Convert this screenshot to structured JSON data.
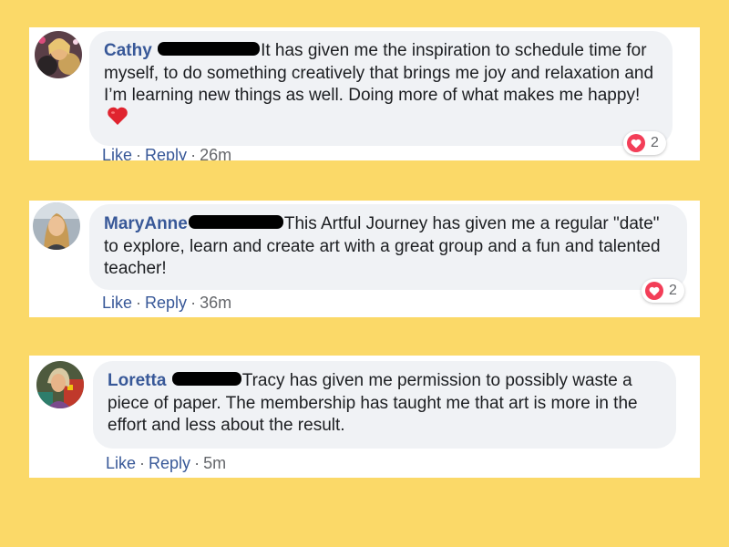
{
  "comments": [
    {
      "author": "Cathy",
      "text": "It has given me the inspiration to schedule time for myself, to do something creatively that brings me joy and relaxation and I’m learning new things as well. Doing more of what makes me happy!",
      "actions": {
        "like": "Like",
        "reply": "Reply",
        "time": "26m"
      },
      "reaction_count": "2"
    },
    {
      "author": "MaryAnne",
      "text": "This Artful Journey has given me a regular \"date\" to explore, learn and create art with a great group and a fun and talented teacher!",
      "actions": {
        "like": "Like",
        "reply": "Reply",
        "time": "36m"
      },
      "reaction_count": "2"
    },
    {
      "author": "Loretta",
      "text": "Tracy has given me permission to possibly waste a piece of paper. The membership has taught me that art is more in the effort and less about the result.",
      "actions": {
        "like": "Like",
        "reply": "Reply",
        "time": "5m"
      }
    }
  ],
  "separator": "·",
  "colors": {
    "background": "#fbd968",
    "bubble": "#f0f2f5",
    "author": "#385898",
    "meta": "#65676b",
    "love_reaction": "#f33e58",
    "heart_emoji": "#e0242f"
  },
  "icons": [
    "love-reaction-icon",
    "heart-emoji-icon",
    "redaction-mark"
  ]
}
